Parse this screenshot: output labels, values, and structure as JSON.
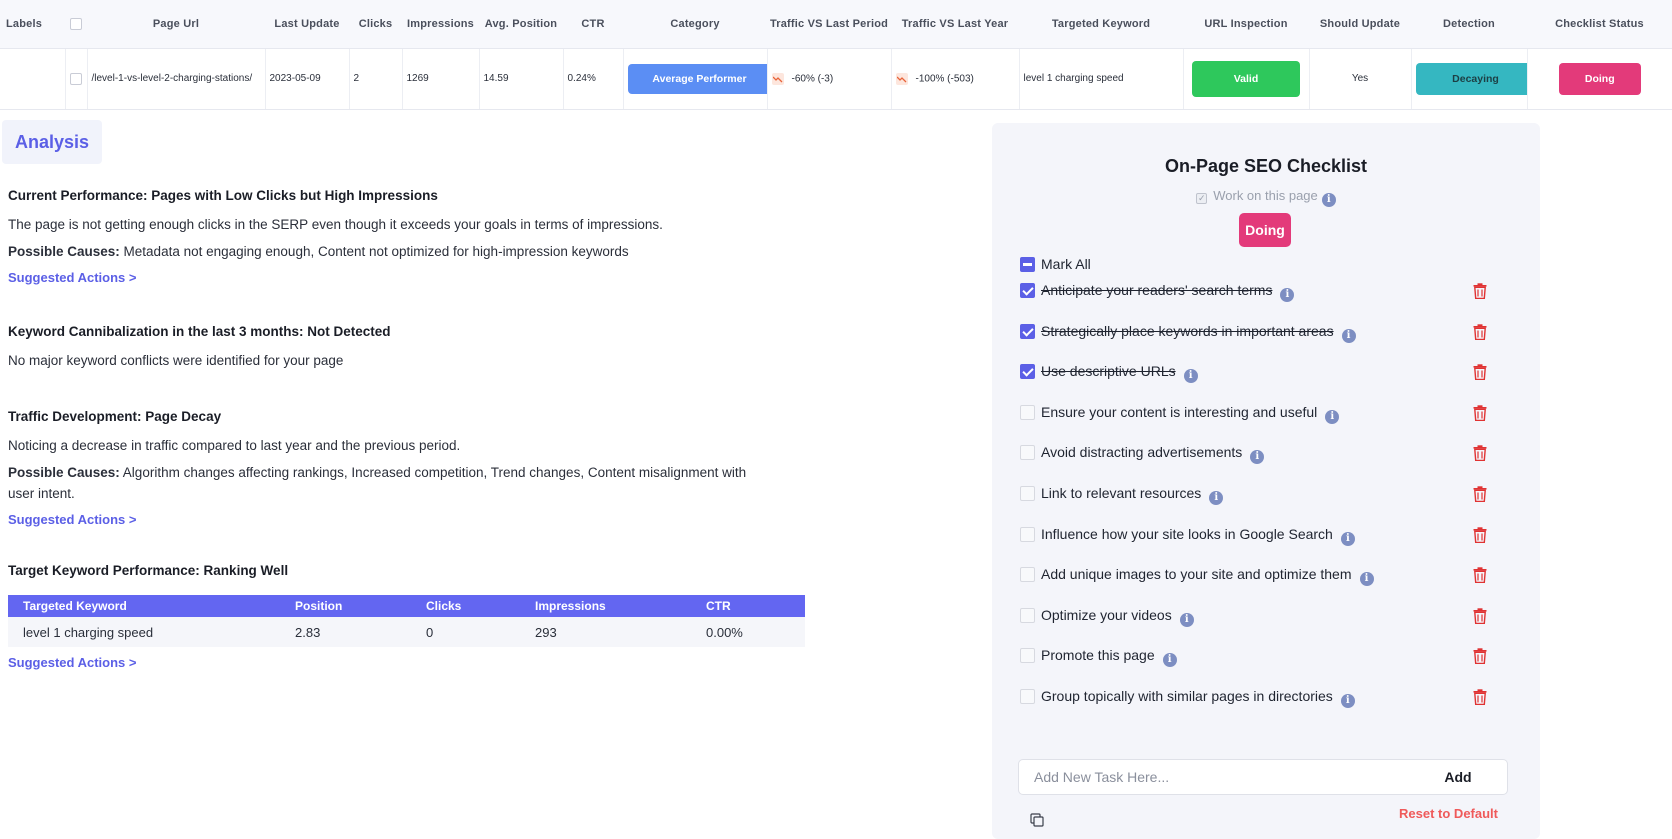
{
  "table": {
    "headers": {
      "labels": "Labels",
      "page_url": "Page Url",
      "last_update": "Last Update",
      "clicks": "Clicks",
      "impressions": "Impressions",
      "avg_position": "Avg. Position",
      "ctr": "CTR",
      "category": "Category",
      "traffic_vs_last_period": "Traffic VS Last Period",
      "traffic_vs_last_year": "Traffic VS Last Year",
      "targeted_keyword": "Targeted Keyword",
      "url_inspection": "URL Inspection",
      "should_update": "Should Update",
      "detection": "Detection",
      "checklist_status": "Checklist Status"
    },
    "row": {
      "page_url": "/level-1-vs-level-2-charging-stations/",
      "last_update": "2023-05-09",
      "clicks": "2",
      "impressions": "1269",
      "avg_position": "14.59",
      "ctr": "0.24%",
      "category": "Average Performer",
      "traffic_vs_last_period": "-60% (-3)",
      "traffic_vs_last_year": "-100% (-503)",
      "targeted_keyword": "level 1 charging speed",
      "url_inspection": "Valid",
      "should_update": "Yes",
      "detection": "Decaying",
      "checklist_status": "Doing"
    }
  },
  "analysis": {
    "tab_label": "Analysis",
    "sections": [
      {
        "title": "Current Performance: Pages with Low Clicks but High Impressions",
        "text": "The page is not getting enough clicks in the SERP even though it exceeds your goals in terms of impressions.",
        "causes_label": "Possible Causes:",
        "causes": " Metadata not engaging enough, Content not optimized for high-impression keywords",
        "link": "Suggested Actions >"
      },
      {
        "title": "Keyword Cannibalization in the last 3 months: Not Detected",
        "text": "No major keyword conflicts were identified for your page"
      },
      {
        "title": "Traffic Development: Page Decay",
        "text": "Noticing a decrease in traffic compared to last year and the previous period.",
        "causes_label": "Possible Causes:",
        "causes": " Algorithm changes affecting rankings, Increased competition, Trend changes, Content misalignment with user intent.",
        "link": "Suggested Actions >"
      },
      {
        "title": "Target Keyword Performance: Ranking Well",
        "link": "Suggested Actions >"
      }
    ],
    "kw_table": {
      "headers": [
        "Targeted Keyword",
        "Position",
        "Clicks",
        "Impressions",
        "CTR"
      ],
      "row": [
        "level 1 charging speed",
        "2.83",
        "0",
        "293",
        "0.00%"
      ]
    }
  },
  "checklist": {
    "title": "On-Page SEO Checklist",
    "work_label": "Work on this page",
    "status": "Doing",
    "mark_all": "Mark All",
    "tasks": [
      {
        "label": "Anticipate your readers' search terms",
        "done": true
      },
      {
        "label": "Strategically place keywords in important areas",
        "done": true
      },
      {
        "label": "Use descriptive URLs",
        "done": true
      },
      {
        "label": "Ensure your content is interesting and useful",
        "done": false
      },
      {
        "label": "Avoid distracting advertisements",
        "done": false
      },
      {
        "label": "Link to relevant resources",
        "done": false
      },
      {
        "label": "Influence how your site looks in Google Search",
        "done": false
      },
      {
        "label": "Add unique images to your site and optimize them",
        "done": false
      },
      {
        "label": "Optimize your videos",
        "done": false
      },
      {
        "label": "Promote this page",
        "done": false
      },
      {
        "label": "Group topically with similar pages in directories",
        "done": false
      }
    ],
    "add_placeholder": "Add New Task Here...",
    "add_label": "Add",
    "reset_label": "Reset to Default"
  },
  "colors": {
    "accent": "#5b5fe6",
    "doing": "#e33a7a",
    "valid": "#2ec85c",
    "decaying": "#35b7c1",
    "average_performer": "#5b8ef4",
    "trash": "#e03232",
    "reset": "#ef5a5a"
  },
  "icons": {
    "info": "info-icon",
    "trash": "trash-icon",
    "copy": "copy-icon",
    "trend": "trend-down-icon"
  }
}
